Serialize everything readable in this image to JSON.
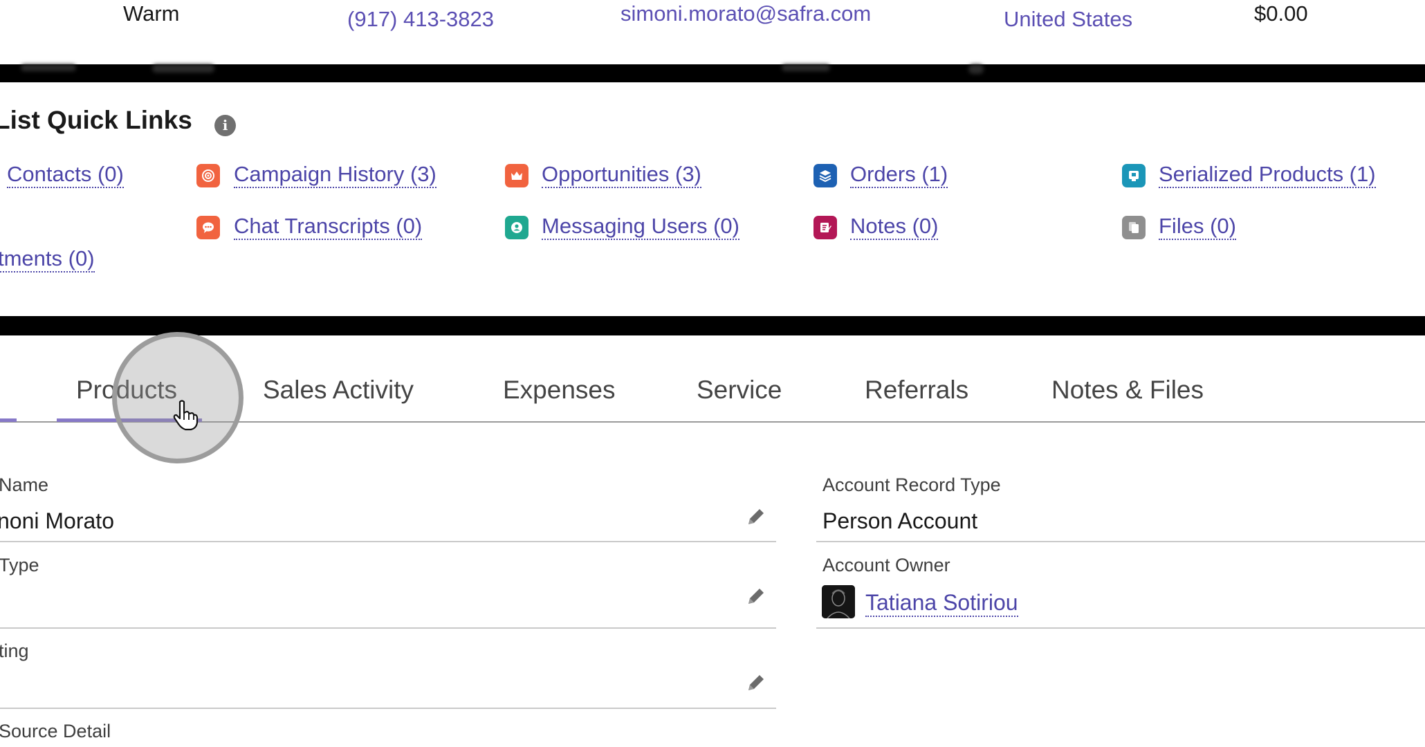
{
  "summary_row": {
    "rating": "Warm",
    "phone": "(917) 413-3823",
    "email": "simoni.morato@safra.com",
    "country": "United States",
    "amount": "$0.00"
  },
  "quick_links": {
    "title": "List Quick Links",
    "info_icon": "info-icon",
    "items": [
      {
        "label": "Contacts (0)",
        "icon": "none"
      },
      {
        "label": "Campaign History (3)",
        "icon": "campaign-icon",
        "color": "#f1633f"
      },
      {
        "label": "Opportunities (3)",
        "icon": "crown-icon",
        "color": "#f1633f"
      },
      {
        "label": "Orders (1)",
        "icon": "stack-icon",
        "color": "#1d61b3"
      },
      {
        "label": "Serialized Products (1)",
        "icon": "product-icon",
        "color": "#1b96b8"
      },
      {
        "label": "Chat Transcripts (0)",
        "icon": "chat-icon",
        "color": "#f1633f"
      },
      {
        "label": "Messaging Users (0)",
        "icon": "messaging-user-icon",
        "color": "#1fa890"
      },
      {
        "label": "Notes (0)",
        "icon": "note-icon",
        "color": "#b31756"
      },
      {
        "label": "Files (0)",
        "icon": "file-icon",
        "color": "#8f8f8f"
      },
      {
        "label": "tments (0)",
        "icon": "none"
      }
    ]
  },
  "tabs": [
    {
      "label": "Products",
      "active": true
    },
    {
      "label": "Sales Activity"
    },
    {
      "label": "Expenses"
    },
    {
      "label": "Service"
    },
    {
      "label": "Referrals"
    },
    {
      "label": "Notes & Files"
    }
  ],
  "details": {
    "left": [
      {
        "label": "Name",
        "value": "noni Morato"
      },
      {
        "label": "Type",
        "value": ""
      },
      {
        "label": "ting",
        "value": ""
      },
      {
        "label": "Source Detail",
        "value": ""
      }
    ],
    "right": [
      {
        "label": "Account Record Type",
        "value": "Person Account"
      },
      {
        "label": "Account Owner",
        "value": "Tatiana Sotiriou"
      }
    ]
  },
  "colors": {
    "link": "#4c45a8",
    "tab_active": "#8779c8"
  }
}
